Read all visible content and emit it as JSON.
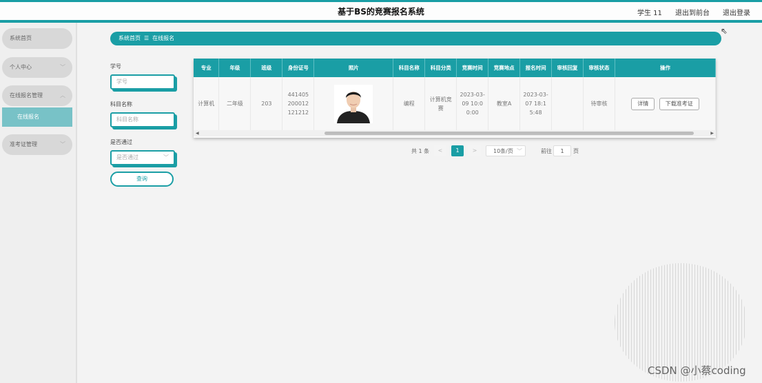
{
  "app": {
    "title": "基于BS的竞赛报名系统"
  },
  "header": {
    "user": "学生 11",
    "front_link": "退出到前台",
    "logout": "退出登录"
  },
  "sidebar": {
    "items": [
      {
        "label": "系统首页"
      },
      {
        "label": "个人中心"
      },
      {
        "label": "在线报名管理"
      },
      {
        "label": "准考证管理"
      }
    ],
    "active_sub": "在线报名"
  },
  "breadcrumb": {
    "home": "系统首页",
    "sep": "☰",
    "current": "在线报名"
  },
  "filters": {
    "student_no_label": "学号",
    "student_no_placeholder": "学号",
    "subject_label": "科目名称",
    "subject_placeholder": "科目名称",
    "passed_label": "是否通过",
    "passed_placeholder": "是否通过",
    "search_button": "查询"
  },
  "table": {
    "headers": [
      "专业",
      "年级",
      "班级",
      "身份证号",
      "照片",
      "科目名称",
      "科目分类",
      "竞赛时间",
      "竞赛地点",
      "报名时间",
      "审核回复",
      "审核状态",
      "操作"
    ],
    "row": {
      "major": "计算机",
      "grade": "二年级",
      "class": "203",
      "id_number": "441405200012121212",
      "subject": "编程",
      "category": "计算机竞赛",
      "contest_time": "2023-03-09 10:00:00",
      "location": "教室A",
      "register_time": "2023-03-07 18:15:48",
      "review_reply": "",
      "review_status": "待审核",
      "detail_button": "详情",
      "download_button": "下载准考证"
    }
  },
  "pagination": {
    "total": "共 1 条",
    "current": "1",
    "page_size": "10条/页",
    "goto_label": "前往",
    "goto_value": "1",
    "page_suffix": "页"
  },
  "watermark": "CSDN @小蔡coding",
  "icons": {
    "chevron": "chevron-down-icon",
    "prev": "chevron-left-icon",
    "next": "chevron-right-icon"
  },
  "colors": {
    "accent": "#1a9ea5",
    "submenu": "#78c2c7"
  }
}
